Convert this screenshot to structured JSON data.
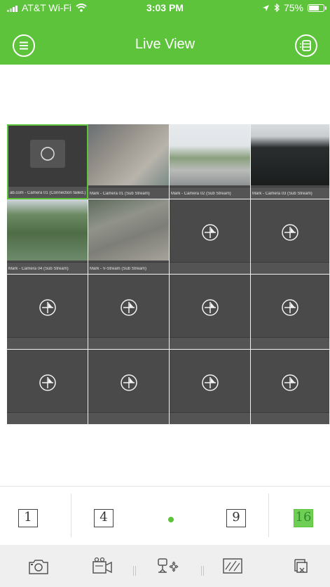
{
  "status_bar": {
    "carrier": "AT&T Wi-Fi",
    "time": "3:03 PM",
    "battery": "75%",
    "battery_level": 0.75
  },
  "nav": {
    "title": "Live View"
  },
  "cameras": [
    {
      "caption": "ab.com - Camera 01 (Connection failed.)",
      "state": "failed"
    },
    {
      "caption": "Mark - Camera 01 (Sub Stream)",
      "state": "live"
    },
    {
      "caption": "Mark - Camera 02 (Sub Stream)",
      "state": "live"
    },
    {
      "caption": "Mark - Camera 03 (Sub Stream)",
      "state": "live"
    },
    {
      "caption": "Mark - Camera 04 (Sub Stream)",
      "state": "live"
    },
    {
      "caption": "Mark - V-Stream (Sub Stream)",
      "state": "live"
    }
  ],
  "split_modes": {
    "one": "1",
    "four": "4",
    "nine": "9",
    "sixteen": "16",
    "selected": "16"
  },
  "colors": {
    "accent": "#5cc33a",
    "cell_bg": "#4a4a4a"
  },
  "icons": {
    "menu": "hamburger-circle-icon",
    "layout": "layout-switch-icon",
    "add_channel": "add-channel-icon",
    "refresh": "refresh-icon",
    "snapshot": "camera-snapshot-icon",
    "record": "video-record-icon",
    "ptz": "ptz-control-icon",
    "quality": "stream-quality-icon",
    "close_all": "close-all-windows-icon"
  }
}
